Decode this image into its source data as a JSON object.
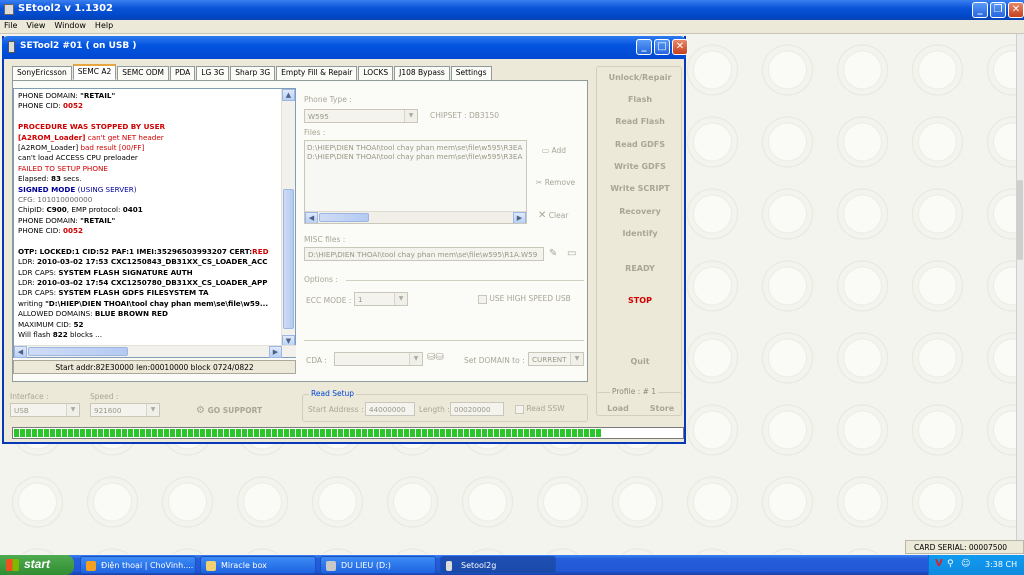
{
  "app": {
    "title": "SEtool2 v 1.1302",
    "menu": [
      "File",
      "View",
      "Window",
      "Help"
    ]
  },
  "child": {
    "title": "SETool2 #01 ( on USB )"
  },
  "tabs": [
    "SonyEricsson",
    "SEMC A2",
    "SEMC ODM",
    "PDA",
    "LG 3G",
    "Sharp 3G",
    "Empty Fill & Repair",
    "LOCKS",
    "J108 Bypass",
    "Settings"
  ],
  "active_tab": "SEMC A2",
  "log": {
    "lines": [
      [
        {
          "t": "PHONE DOMAIN: "
        },
        {
          "t": "\"RETAIL\"",
          "c": "b"
        }
      ],
      [
        {
          "t": "PHONE CID: "
        },
        {
          "t": "0052",
          "c": "red b"
        }
      ],
      [
        {
          "t": ""
        }
      ],
      [
        {
          "t": "PROCEDURE WAS STOPPED BY USER",
          "c": "red b"
        }
      ],
      [
        {
          "t": "[A2ROM_Loader]",
          "c": "red b"
        },
        {
          "t": " can't get NET header",
          "c": "red"
        }
      ],
      [
        {
          "t": "[A2ROM_Loader] "
        },
        {
          "t": "bad result [00/FF]",
          "c": "red"
        }
      ],
      [
        {
          "t": "can't load ACCESS CPU preloader"
        }
      ],
      [
        {
          "t": "FAILED TO SETUP PHONE",
          "c": "red"
        }
      ],
      [
        {
          "t": "Elapsed: "
        },
        {
          "t": "83",
          "c": "b"
        },
        {
          "t": " secs."
        }
      ],
      [
        {
          "t": "SIGNED MODE",
          "c": "blue b"
        },
        {
          "t": " (USING SERVER)",
          "c": "blue"
        }
      ],
      [
        {
          "t": "CFG: 101010000000",
          "c": "gray"
        }
      ],
      [
        {
          "t": "ChipID: "
        },
        {
          "t": "C900",
          "c": "b"
        },
        {
          "t": ", EMP protocol: "
        },
        {
          "t": "0401",
          "c": "b"
        }
      ],
      [
        {
          "t": "PHONE DOMAIN: "
        },
        {
          "t": "\"RETAIL\"",
          "c": "b"
        }
      ],
      [
        {
          "t": "PHONE CID: "
        },
        {
          "t": "0052",
          "c": "red b"
        }
      ],
      [
        {
          "t": ""
        }
      ],
      [
        {
          "t": "OTP: ",
          "c": "b"
        },
        {
          "t": "LOCKED:1 CID:52 PAF:1 IMEI:35296503993207 CERT:",
          "c": "b"
        },
        {
          "t": "RED",
          "c": "red b"
        }
      ],
      [
        {
          "t": "LDR: "
        },
        {
          "t": "2010-03-02 17:53 CXC1250843_DB31XX_CS_LOADER_ACC",
          "c": "b"
        }
      ],
      [
        {
          "t": "LDR CAPS: "
        },
        {
          "t": "SYSTEM FLASH SIGNATURE AUTH",
          "c": "b"
        }
      ],
      [
        {
          "t": "LDR: "
        },
        {
          "t": "2010-03-02 17:54 CXC1250780_DB31XX_CS_LOADER_APP",
          "c": "b"
        }
      ],
      [
        {
          "t": "LDR CAPS: "
        },
        {
          "t": "SYSTEM FLASH GDFS FILESYSTEM TA",
          "c": "b"
        }
      ],
      [
        {
          "t": "writing "
        },
        {
          "t": "\"D:\\HIEP\\DIEN THOAI\\tool chay phan mem\\se\\file\\w59...",
          "c": "b"
        }
      ],
      [
        {
          "t": "ALLOWED DOMAINS: "
        },
        {
          "t": "BLUE BROWN RED",
          "c": "b"
        }
      ],
      [
        {
          "t": "MAXIMUM CID: "
        },
        {
          "t": "52",
          "c": "b"
        }
      ],
      [
        {
          "t": "Will flash "
        },
        {
          "t": "822",
          "c": "b"
        },
        {
          "t": " blocks ..."
        }
      ]
    ],
    "status": "Start addr:82E30000 len:00010000 block 0724/0822"
  },
  "phone_type": {
    "label": "Phone Type :",
    "value": "W595",
    "chipset": "CHIPSET : DB3150"
  },
  "files": {
    "label": "Files :",
    "items": [
      "D:\\HIEP\\DIEN THOAI\\tool chay phan mem\\se\\file\\w595\\R3EA",
      "D:\\HIEP\\DIEN THOAI\\tool chay phan mem\\se\\file\\w595\\R3EA"
    ],
    "add": "Add",
    "remove": "Remove",
    "clear": "Clear"
  },
  "misc": {
    "label": "MISC files :",
    "value": "D:\\HIEP\\DIEN THOAI\\tool chay phan mem\\se\\file\\w595\\R1A.W59"
  },
  "options": {
    "label": "Options :",
    "ecc_label": "ECC MODE :",
    "ecc_value": "1",
    "use_high_speed": "USE HIGH SPEED USB"
  },
  "cda": {
    "label": "CDA :",
    "value": "",
    "set_domain_label": "Set DOMAIN to :",
    "domain_value": "CURRENT"
  },
  "actions": {
    "unlock": "Unlock/Repair",
    "flash": "Flash",
    "read_flash": "Read Flash",
    "read_gdfs": "Read GDFS",
    "write_gdfs": "Write GDFS",
    "write_script": "Write SCRIPT",
    "recovery": "Recovery",
    "identify": "Identify",
    "ready": "READY",
    "stop": "STOP",
    "quit": "Quit",
    "profile": "Profile : # 1",
    "load": "Load",
    "store": "Store"
  },
  "interface": {
    "label": "Interface :",
    "value": "USB"
  },
  "speed": {
    "label": "Speed :",
    "value": "921600"
  },
  "go_support": "GO SUPPORT",
  "read_setup": {
    "title": "Read Setup",
    "start_label": "Start Address :",
    "start_value": "44000000",
    "length_label": "Length :",
    "length_value": "00020000",
    "read_ssw": "Read SSW"
  },
  "progress": 0.88,
  "card_serial": "CARD SERIAL: 00007500",
  "taskbar": {
    "start": "start",
    "tasks": [
      "Điện thoại | ChoVinh....",
      "Miracle box",
      "DU LIEU (D:)",
      "Setool2g"
    ],
    "clock": "3:38 CH"
  },
  "colors": {
    "title_blue": "#0a54d8",
    "stop_red": "#d00000",
    "progress_green": "#2bc42b",
    "taskbar_blue": "#245edb"
  }
}
